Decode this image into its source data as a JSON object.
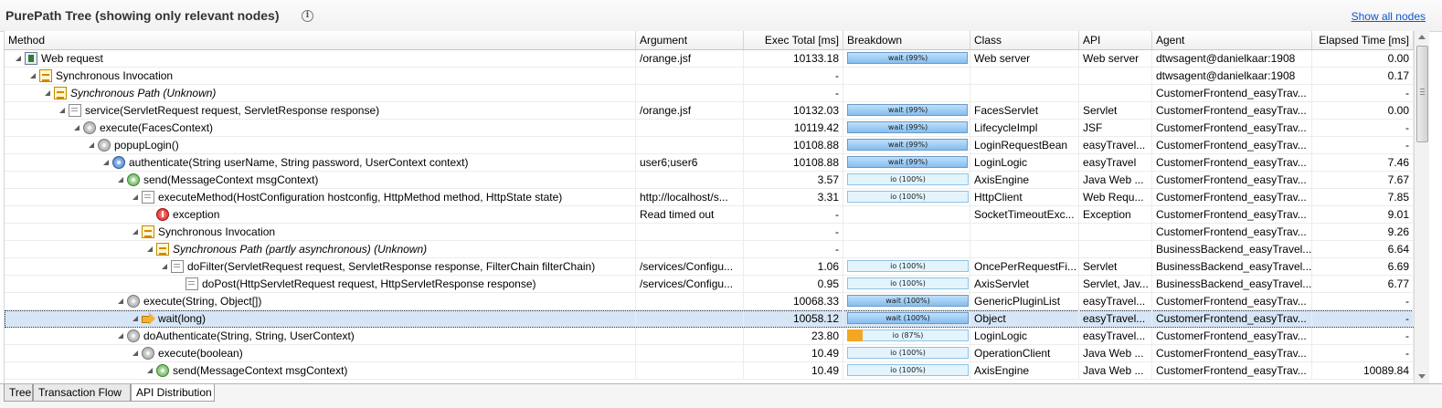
{
  "panel": {
    "title": "PurePath Tree (showing only relevant nodes)",
    "show_all_link": "Show all nodes"
  },
  "columns": [
    {
      "key": "method",
      "label": "Method"
    },
    {
      "key": "argument",
      "label": "Argument"
    },
    {
      "key": "exec_total",
      "label": "Exec Total [ms]"
    },
    {
      "key": "breakdown",
      "label": "Breakdown"
    },
    {
      "key": "class",
      "label": "Class"
    },
    {
      "key": "api",
      "label": "API"
    },
    {
      "key": "agent",
      "label": "Agent"
    },
    {
      "key": "elapsed",
      "label": "Elapsed Time [ms]"
    }
  ],
  "rows": [
    {
      "depth": 0,
      "icon": "web-request-icon",
      "method": "Web request",
      "italic": false,
      "argument": "/orange.jsf",
      "exec_total": "10133.18",
      "breakdown": {
        "label": "wait (99%)",
        "kind": "wait",
        "percent": 99
      },
      "class": "Web server",
      "api": "Web server",
      "agent": "dtwsagent@danielkaar:1908",
      "elapsed": "0.00"
    },
    {
      "depth": 1,
      "icon": "synchronous-invocation-icon",
      "method": "Synchronous Invocation",
      "italic": false,
      "argument": "",
      "exec_total": "-",
      "breakdown": null,
      "class": "",
      "api": "",
      "agent": "dtwsagent@danielkaar:1908",
      "elapsed": "0.17"
    },
    {
      "depth": 2,
      "icon": "synchronous-path-icon",
      "method": "Synchronous Path (Unknown)",
      "italic": true,
      "argument": "",
      "exec_total": "-",
      "breakdown": null,
      "class": "",
      "api": "",
      "agent": "CustomerFrontend_easyTrav...",
      "elapsed": "-"
    },
    {
      "depth": 3,
      "icon": "servlet-document-icon",
      "method": "service(ServletRequest request, ServletResponse response)",
      "italic": false,
      "argument": "/orange.jsf",
      "exec_total": "10132.03",
      "breakdown": {
        "label": "wait (99%)",
        "kind": "wait",
        "percent": 99
      },
      "class": "FacesServlet",
      "api": "Servlet",
      "agent": "CustomerFrontend_easyTrav...",
      "elapsed": "0.00"
    },
    {
      "depth": 4,
      "icon": "method-icon",
      "method": "execute(FacesContext)",
      "italic": false,
      "argument": "",
      "exec_total": "10119.42",
      "breakdown": {
        "label": "wait (99%)",
        "kind": "wait",
        "percent": 99
      },
      "class": "LifecycleImpl",
      "api": "JSF",
      "agent": "CustomerFrontend_easyTrav...",
      "elapsed": "-"
    },
    {
      "depth": 5,
      "icon": "method-icon",
      "method": "popupLogin()",
      "italic": false,
      "argument": "",
      "exec_total": "10108.88",
      "breakdown": {
        "label": "wait (99%)",
        "kind": "wait",
        "percent": 99
      },
      "class": "LoginRequestBean",
      "api": "easyTravel...",
      "agent": "CustomerFrontend_easyTrav...",
      "elapsed": "-"
    },
    {
      "depth": 6,
      "icon": "method-blue-icon",
      "method": "authenticate(String userName, String password, UserContext context)",
      "italic": false,
      "argument": "user6;user6",
      "exec_total": "10108.88",
      "breakdown": {
        "label": "wait (99%)",
        "kind": "wait",
        "percent": 99
      },
      "class": "LoginLogic",
      "api": "easyTravel",
      "agent": "CustomerFrontend_easyTrav...",
      "elapsed": "7.46"
    },
    {
      "depth": 7,
      "icon": "method-green-icon",
      "method": "send(MessageContext msgContext)",
      "italic": false,
      "argument": "",
      "exec_total": "3.57",
      "breakdown": {
        "label": "io (100%)",
        "kind": "io",
        "percent": 100
      },
      "class": "AxisEngine",
      "api": "Java Web ...",
      "agent": "CustomerFrontend_easyTrav...",
      "elapsed": "7.67"
    },
    {
      "depth": 8,
      "icon": "http-document-icon",
      "method": "executeMethod(HostConfiguration hostconfig, HttpMethod method, HttpState state)",
      "italic": false,
      "argument": "http://localhost/s...",
      "exec_total": "3.31",
      "breakdown": {
        "label": "io (100%)",
        "kind": "io",
        "percent": 100
      },
      "class": "HttpClient",
      "api": "Web Requ...",
      "agent": "CustomerFrontend_easyTrav...",
      "elapsed": "7.85"
    },
    {
      "depth": 9,
      "icon": "exception-icon",
      "method": "exception",
      "italic": false,
      "argument": "Read timed out",
      "exec_total": "-",
      "breakdown": null,
      "class": "SocketTimeoutExc...",
      "api": "Exception",
      "agent": "CustomerFrontend_easyTrav...",
      "elapsed": "9.01"
    },
    {
      "depth": 8,
      "icon": "synchronous-invocation-icon",
      "method": "Synchronous Invocation",
      "italic": false,
      "argument": "",
      "exec_total": "-",
      "breakdown": null,
      "class": "",
      "api": "",
      "agent": "CustomerFrontend_easyTrav...",
      "elapsed": "9.26"
    },
    {
      "depth": 9,
      "icon": "synchronous-path-icon",
      "method": "Synchronous Path (partly asynchronous) (Unknown)",
      "italic": true,
      "argument": "",
      "exec_total": "-",
      "breakdown": null,
      "class": "",
      "api": "",
      "agent": "BusinessBackend_easyTravel...",
      "elapsed": "6.64"
    },
    {
      "depth": 10,
      "icon": "servlet-document-icon",
      "method": "doFilter(ServletRequest request, ServletResponse response, FilterChain filterChain)",
      "italic": false,
      "argument": "/services/Configu...",
      "exec_total": "1.06",
      "breakdown": {
        "label": "io (100%)",
        "kind": "io",
        "percent": 100
      },
      "class": "OncePerRequestFi...",
      "api": "Servlet",
      "agent": "BusinessBackend_easyTravel...",
      "elapsed": "6.69"
    },
    {
      "depth": 11,
      "icon": "servlet-document-icon",
      "method": "doPost(HttpServletRequest request, HttpServletResponse response)",
      "italic": false,
      "argument": "/services/Configu...",
      "exec_total": "0.95",
      "breakdown": {
        "label": "io (100%)",
        "kind": "io",
        "percent": 100
      },
      "class": "AxisServlet",
      "api": "Servlet, Jav...",
      "agent": "BusinessBackend_easyTravel...",
      "elapsed": "6.77"
    },
    {
      "depth": 7,
      "icon": "method-icon",
      "method": "execute(String, Object[])",
      "italic": false,
      "argument": "",
      "exec_total": "10068.33",
      "breakdown": {
        "label": "wait (100%)",
        "kind": "wait",
        "percent": 100
      },
      "class": "GenericPluginList",
      "api": "easyTravel...",
      "agent": "CustomerFrontend_easyTrav...",
      "elapsed": "-"
    },
    {
      "depth": 8,
      "icon": "wait-arrow-icon",
      "method": "wait(long)",
      "italic": false,
      "argument": "",
      "exec_total": "10058.12",
      "breakdown": {
        "label": "wait (100%)",
        "kind": "wait",
        "percent": 100
      },
      "class": "Object",
      "api": "easyTravel...",
      "agent": "CustomerFrontend_easyTrav...",
      "elapsed": "-",
      "selected": true
    },
    {
      "depth": 7,
      "icon": "method-icon",
      "method": "doAuthenticate(String, String, UserContext)",
      "italic": false,
      "argument": "",
      "exec_total": "23.80",
      "breakdown": {
        "label": "io (87%)",
        "kind": "io",
        "percent": 87,
        "cpu_percent": 13
      },
      "class": "LoginLogic",
      "api": "easyTravel...",
      "agent": "CustomerFrontend_easyTrav...",
      "elapsed": "-"
    },
    {
      "depth": 8,
      "icon": "method-icon",
      "method": "execute(boolean)",
      "italic": false,
      "argument": "",
      "exec_total": "10.49",
      "breakdown": {
        "label": "io (100%)",
        "kind": "io",
        "percent": 100
      },
      "class": "OperationClient",
      "api": "Java Web ...",
      "agent": "CustomerFrontend_easyTrav...",
      "elapsed": "-"
    },
    {
      "depth": 9,
      "icon": "method-green-icon",
      "method": "send(MessageContext msgContext)",
      "italic": false,
      "argument": "",
      "exec_total": "10.49",
      "breakdown": {
        "label": "io (100%)",
        "kind": "io",
        "percent": 100
      },
      "class": "AxisEngine",
      "api": "Java Web ...",
      "agent": "CustomerFrontend_easyTrav...",
      "elapsed": "10089.84"
    }
  ],
  "tabs": [
    {
      "label": "Tree",
      "active": false
    },
    {
      "label": "Transaction Flow",
      "active": false
    },
    {
      "label": "API Distribution",
      "active": true
    }
  ],
  "icons": {
    "info": "info-icon",
    "expand": "tree-expanded-twisty-icon"
  }
}
